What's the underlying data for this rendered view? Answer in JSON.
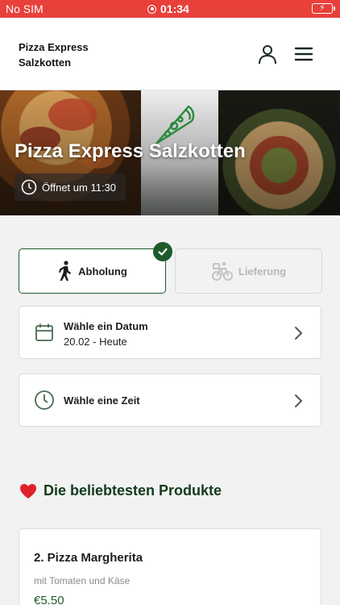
{
  "status_bar": {
    "carrier": "No SIM",
    "time": "01:34",
    "battery_color": "#3cc24a",
    "background": "#e8403a"
  },
  "header": {
    "brand_line1": "Pizza Express",
    "brand_line2": "Salzkotten",
    "icons": [
      "user-icon",
      "menu-icon"
    ]
  },
  "hero": {
    "title": "Pizza Express Salzkotten",
    "opening_text": "Öffnet um 11:30",
    "logo_icon": "pizza-slice-icon"
  },
  "order_mode": {
    "pickup_label": "Abholung",
    "delivery_label": "Lieferung",
    "selected": "pickup",
    "accent": "#1f5a2c"
  },
  "date_selector": {
    "label": "Wähle ein Datum",
    "value": "20.02 - Heute",
    "icon": "calendar-icon"
  },
  "time_selector": {
    "label": "Wähle eine Zeit",
    "icon": "clock-icon"
  },
  "popular": {
    "title": "Die beliebtesten Produkte",
    "icon": "heart-icon",
    "products": [
      {
        "name": "2. Pizza Margherita",
        "description": "mit Tomaten und Käse",
        "price": "€5.50"
      }
    ]
  }
}
